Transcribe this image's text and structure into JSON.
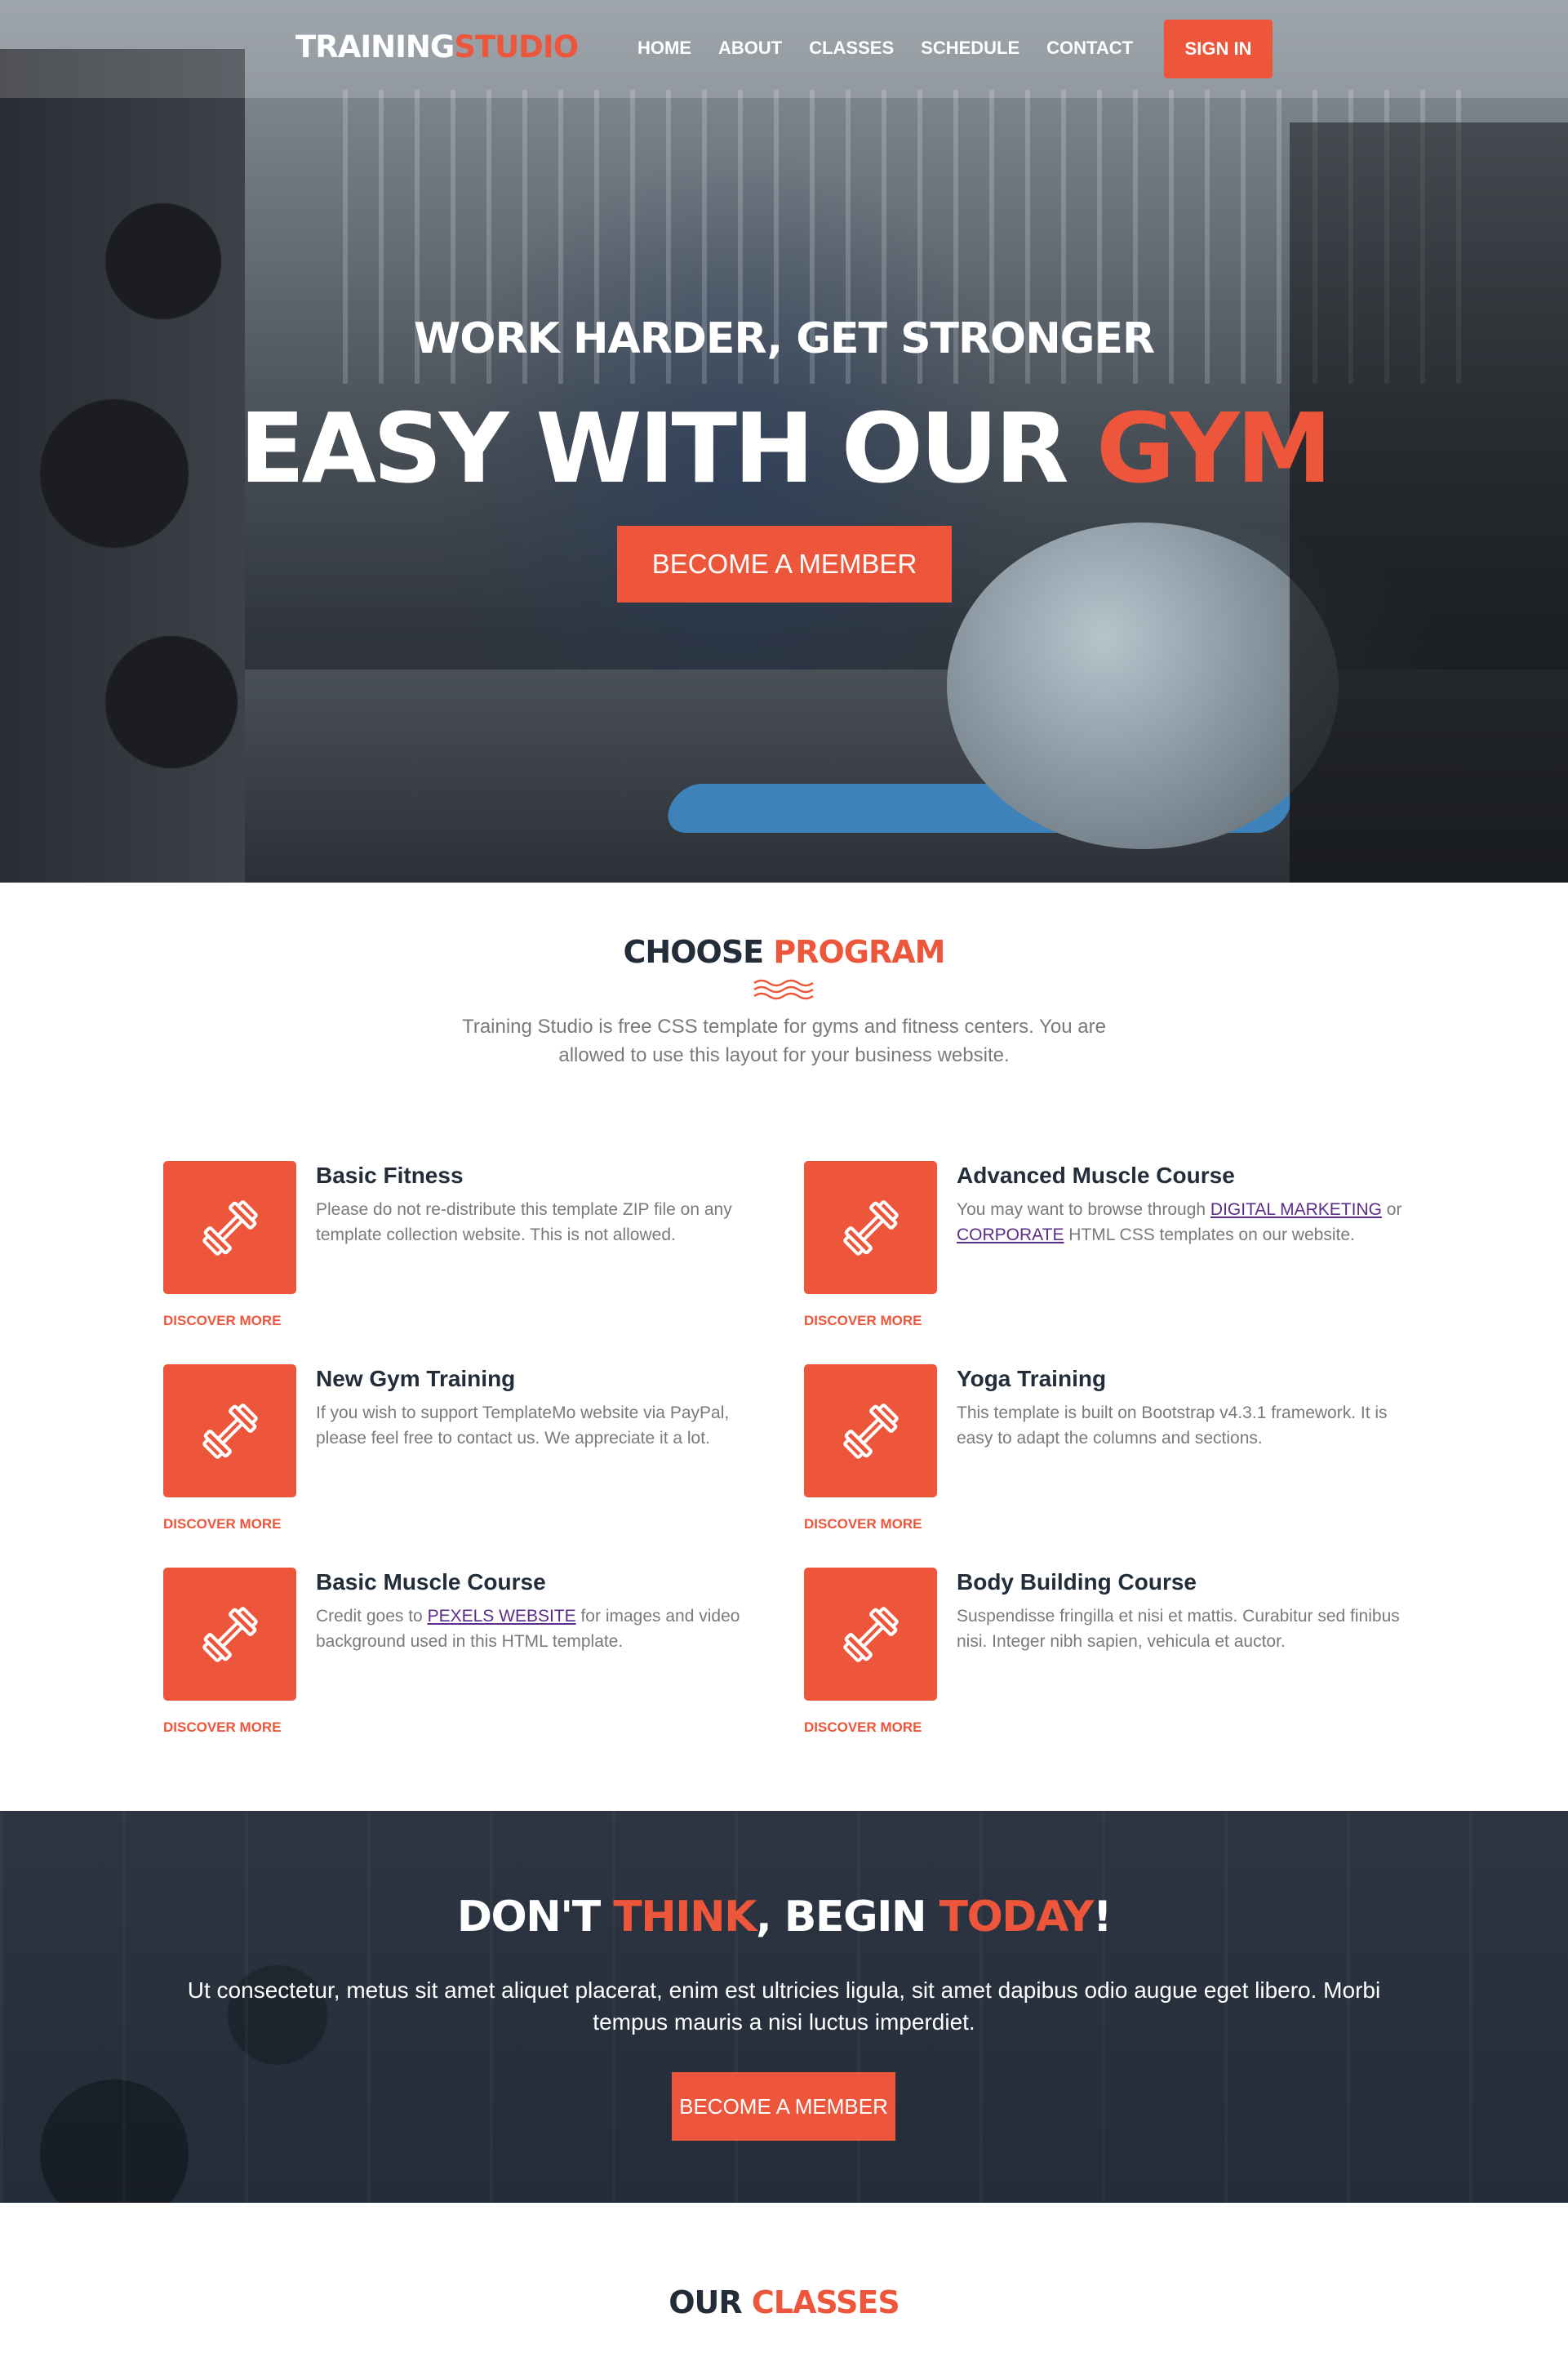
{
  "header": {
    "logo_main": "TRAINING",
    "logo_accent": "STUDIO",
    "nav": [
      "HOME",
      "ABOUT",
      "CLASSES",
      "SCHEDULE",
      "CONTACT"
    ],
    "signin_label": "SIGN IN"
  },
  "hero": {
    "subtitle": "WORK HARDER, GET STRONGER",
    "title_main": "EASY WITH OUR ",
    "title_accent": "GYM",
    "button_label": "BECOME A MEMBER"
  },
  "programs": {
    "title_main": "CHOOSE ",
    "title_accent": "PROGRAM",
    "description": "Training Studio is free CSS template for gyms and fitness centers. You are allowed to use this layout for your business website.",
    "discover_label": "DISCOVER MORE",
    "items": [
      {
        "title": "Basic Fitness",
        "desc": "Please do not re-distribute this template ZIP file on any template collection website. This is not allowed."
      },
      {
        "title": "Advanced Muscle Course",
        "desc_before": "You may want to browse through ",
        "link1": "DIGITAL MARKETING",
        "desc_mid": " or ",
        "link2": "CORPORATE",
        "desc_after": " HTML CSS templates on our website."
      },
      {
        "title": "New Gym Training",
        "desc": "If you wish to support TemplateMo website via PayPal, please feel free to contact us. We appreciate it a lot."
      },
      {
        "title": "Yoga Training",
        "desc": "This template is built on Bootstrap v4.3.1 framework. It is easy to adapt the columns and sections."
      },
      {
        "title": "Basic Muscle Course",
        "desc_before": "Credit goes to ",
        "link1": "PEXELS WEBSITE",
        "desc_after": " for images and video background used in this HTML template."
      },
      {
        "title": "Body Building Course",
        "desc": "Suspendisse fringilla et nisi et mattis. Curabitur sed finibus nisi. Integer nibh sapien, vehicula et auctor."
      }
    ]
  },
  "cta": {
    "title_part1": "DON'T ",
    "title_accent1": "THINK",
    "title_part2": ", BEGIN ",
    "title_accent2": "TODAY",
    "title_part3": "!",
    "description": "Ut consectetur, metus sit amet aliquet placerat, enim est ultricies ligula, sit amet dapibus odio augue eget libero. Morbi tempus mauris a nisi luctus imperdiet.",
    "button_label": "BECOME A MEMBER"
  },
  "classes": {
    "title_main": "OUR ",
    "title_accent": "CLASSES"
  },
  "colors": {
    "accent": "#ed563b",
    "dark": "#232d39",
    "text_muted": "#7a7a7a"
  },
  "icons": {
    "program_icon": "dumbbell-icon"
  }
}
